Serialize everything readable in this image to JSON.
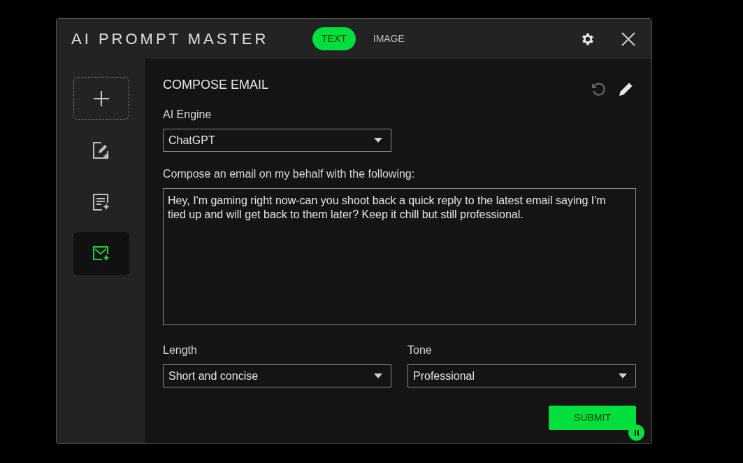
{
  "window": {
    "title": "AI PROMPT MASTER"
  },
  "tabs": [
    {
      "label": "TEXT",
      "selected": true
    },
    {
      "label": "IMAGE",
      "selected": false
    }
  ],
  "sidebar": {
    "items": [
      {
        "kind": "add",
        "selected": false
      },
      {
        "kind": "edit",
        "selected": false
      },
      {
        "kind": "document",
        "selected": false
      },
      {
        "kind": "email",
        "selected": true
      }
    ]
  },
  "content": {
    "title": "COMPOSE EMAIL",
    "reset_disabled": true,
    "engine": {
      "label": "AI Engine",
      "value": "ChatGPT"
    },
    "prompt": {
      "label": "Compose an email on my behalf with the following:",
      "value": "Hey, I'm gaming right now-can you shoot back a quick reply to the latest email saying I'm tied up and will get back to them later? Keep it chill but still professional."
    },
    "length": {
      "label": "Length",
      "value": "Short and concise"
    },
    "tone": {
      "label": "Tone",
      "value": "Professional"
    },
    "submit": "SUBMIT"
  }
}
